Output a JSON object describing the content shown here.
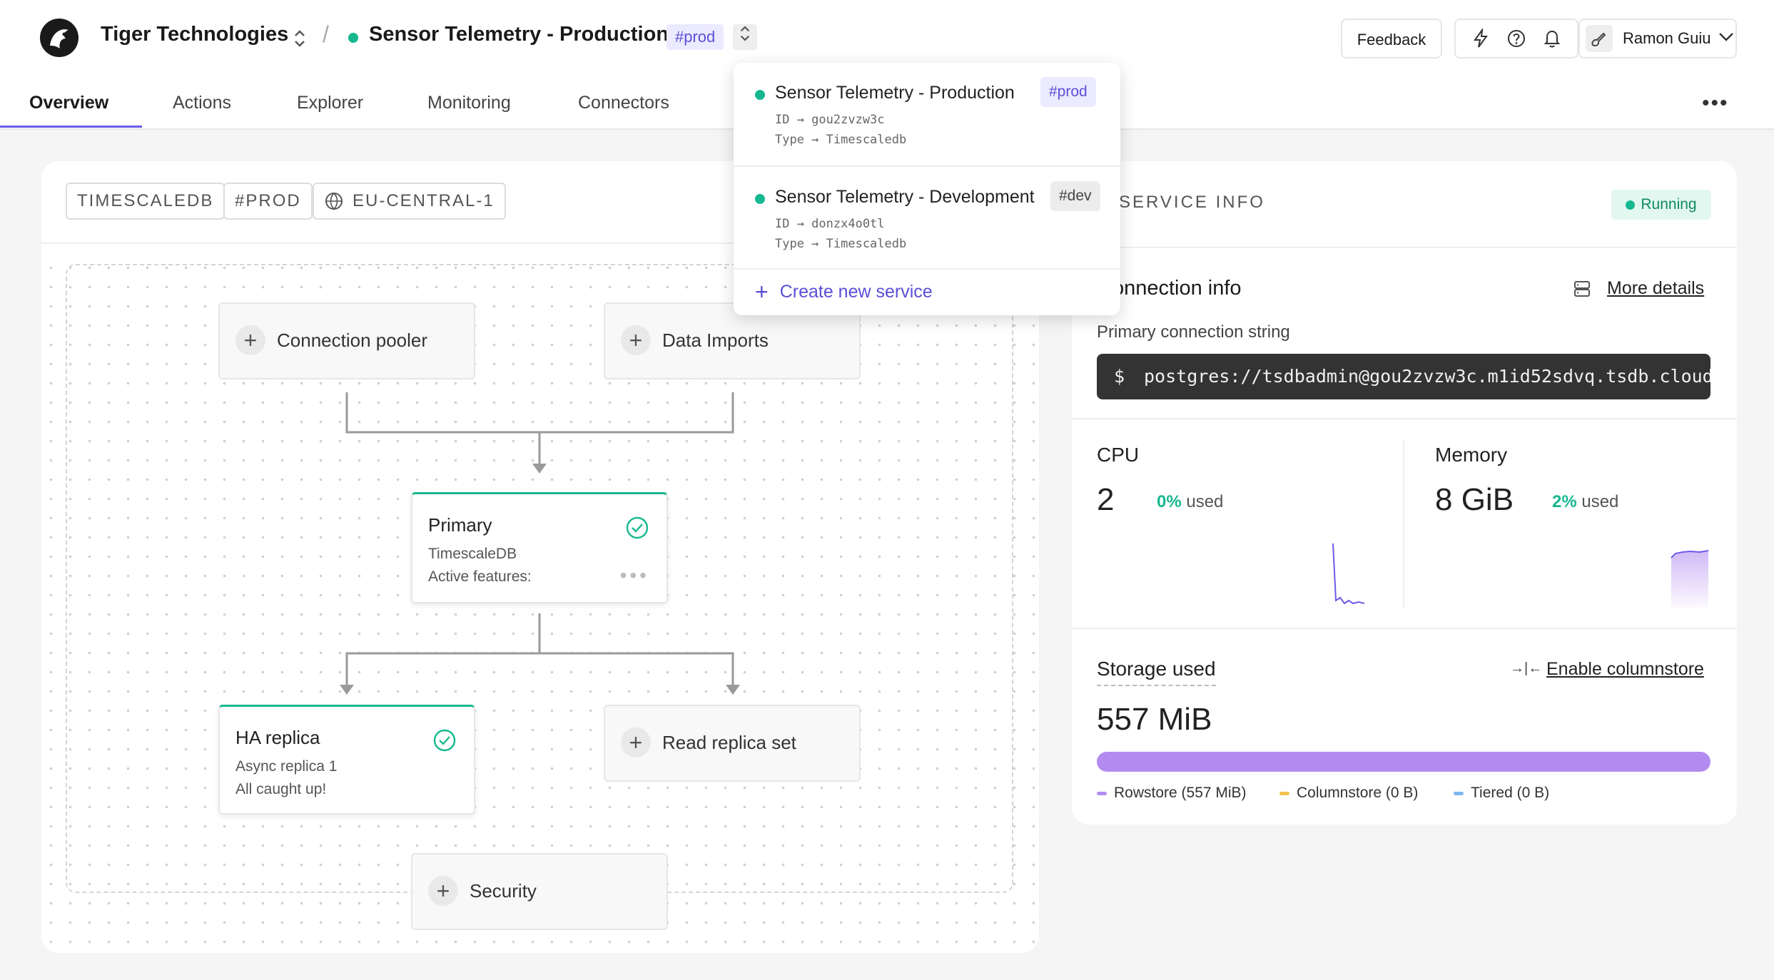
{
  "header": {
    "org_name": "Tiger Technologies",
    "service_name": "Sensor Telemetry - Production",
    "service_tag": "#prod",
    "feedback_label": "Feedback",
    "user_name": "Ramon Guiu"
  },
  "tabs": [
    "Overview",
    "Actions",
    "Explorer",
    "Monitoring",
    "Connectors"
  ],
  "chips": [
    "TIMESCALEDB",
    "#PROD",
    "EU-CENTRAL-1"
  ],
  "diagram": {
    "connection_pooler": "Connection pooler",
    "data_imports": "Data Imports",
    "primary": {
      "title": "Primary",
      "subtitle": "TimescaleDB",
      "features": "Active features:"
    },
    "ha_replica": {
      "title": "HA replica",
      "subtitle": "Async replica 1",
      "status": "All caught up!"
    },
    "read_replica": "Read replica set",
    "security": "Security"
  },
  "service_info": {
    "title": "SERVICE INFO",
    "status": "Running",
    "connection_info_title": "Connection info",
    "more_details": "More details",
    "primary_conn_label": "Primary connection string",
    "prompt": "$",
    "conn_string": "postgres://tsdbadmin@gou2zvzw3c.m1id52sdvq.tsdb.cloud",
    "cpu": {
      "label": "CPU",
      "value": "2",
      "pct": "0%",
      "used": "used"
    },
    "memory": {
      "label": "Memory",
      "value": "8 GiB",
      "pct": "2%",
      "used": "used"
    },
    "storage": {
      "label": "Storage used",
      "enable_columnstore": "Enable columnstore",
      "value": "557 MiB",
      "legend": [
        {
          "label": "Rowstore (557 MiB)",
          "color": "#b38bf0"
        },
        {
          "label": "Columnstore (0 B)",
          "color": "#f2c14e"
        },
        {
          "label": "Tiered (0 B)",
          "color": "#7cb6f0"
        }
      ]
    }
  },
  "dropdown": {
    "items": [
      {
        "name": "Sensor Telemetry - Production",
        "tag": "#prod",
        "id_line": "ID → gou2zvzw3c",
        "type_line": "Type → Timescaledb"
      },
      {
        "name": "Sensor Telemetry - Development",
        "tag": "#dev",
        "id_line": "ID → donzx4o0tl",
        "type_line": "Type → Timescaledb"
      }
    ],
    "create_label": "Create new service"
  },
  "colors": {
    "accent": "#6b5ce7",
    "success": "#17b890",
    "tag_prod_bg": "#eceaff",
    "tag_dev_bg": "#ececec"
  }
}
